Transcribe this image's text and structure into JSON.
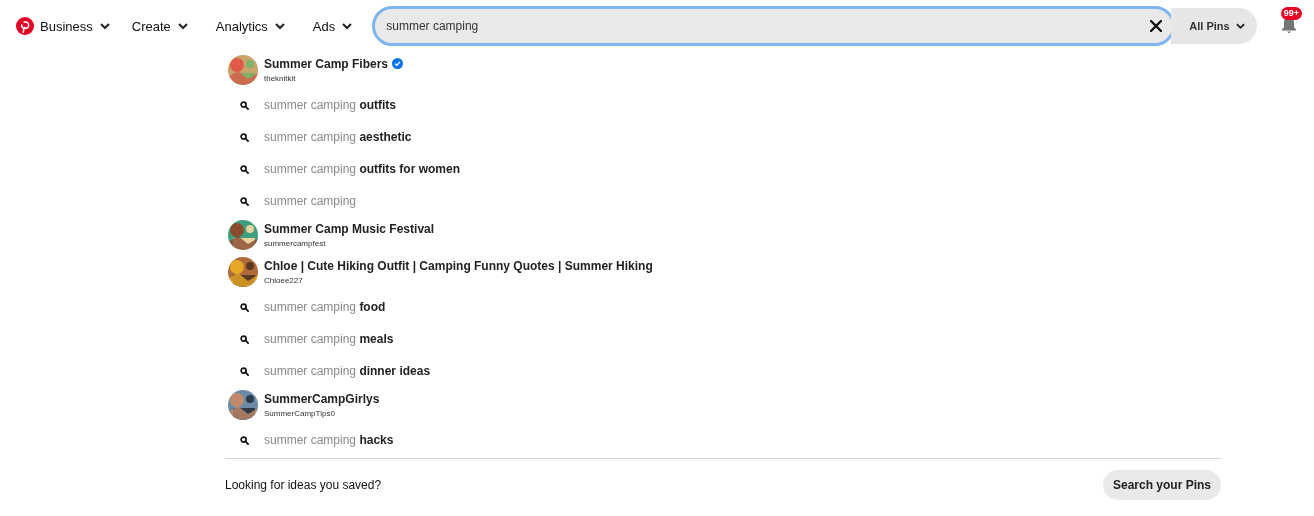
{
  "nav": {
    "items": [
      {
        "label": "Business"
      },
      {
        "label": "Create"
      },
      {
        "label": "Analytics"
      },
      {
        "label": "Ads"
      }
    ]
  },
  "search": {
    "value": "summer camping",
    "scope": "All Pins"
  },
  "notifications": {
    "badge": "99+"
  },
  "suggestions": [
    {
      "kind": "profile",
      "name": "Summer Camp Fibers",
      "handle": "theknitkit",
      "verified": true
    },
    {
      "kind": "query",
      "text": "summer camping **outfits**"
    },
    {
      "kind": "query",
      "text": "summer camping **aesthetic**"
    },
    {
      "kind": "query",
      "text": "summer camping **outfits for women**"
    },
    {
      "kind": "query",
      "text": "summer camping"
    },
    {
      "kind": "profile",
      "name": "Summer Camp Music Festival",
      "handle": "summercampfest",
      "verified": false
    },
    {
      "kind": "profile",
      "name": "Chloe | Cute Hiking Outfit | Camping Funny Quotes | Summer Hiking",
      "handle": "Chloee227",
      "verified": false
    },
    {
      "kind": "query",
      "text": "summer camping **food**"
    },
    {
      "kind": "query",
      "text": "summer camping **meals**"
    },
    {
      "kind": "query",
      "text": "summer camping **dinner ideas**"
    },
    {
      "kind": "profile",
      "name": "SummerCampGirlys",
      "handle": "SummerCampTips0",
      "verified": false
    },
    {
      "kind": "query",
      "text": "summer camping **hacks**"
    }
  ],
  "footer": {
    "prompt": "Looking for ideas you saved?",
    "button": "Search your Pins"
  }
}
